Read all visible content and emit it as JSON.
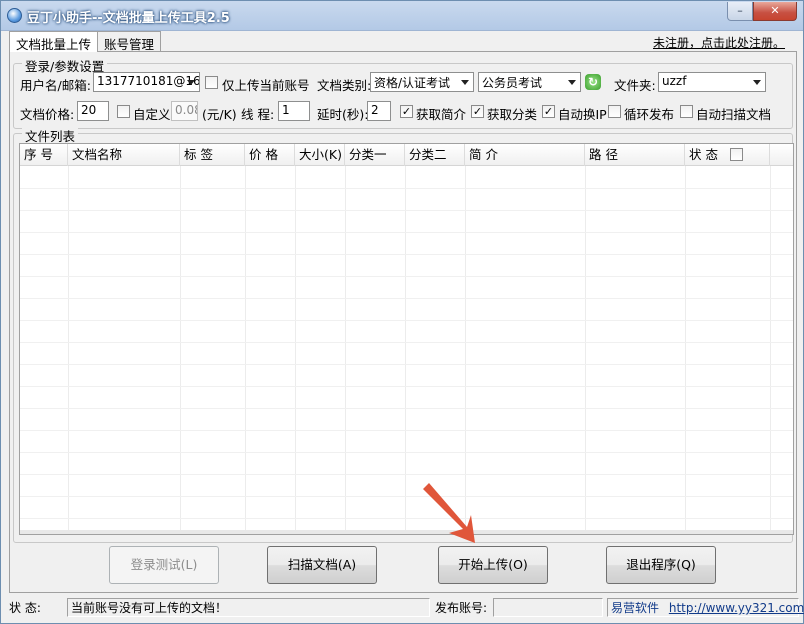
{
  "window": {
    "title": "豆丁小助手--文档批量上传工具2.5",
    "min_label": "–",
    "close_label": "✕"
  },
  "tabs": [
    {
      "label": "文档批量上传",
      "active": true
    },
    {
      "label": "账号管理",
      "active": false
    }
  ],
  "register_link": "未注册，点击此处注册。",
  "login_group": {
    "label": "登录/参数设置",
    "username_label": "用户名/邮箱:",
    "username_value": "1317710181@16.",
    "only_current_label": "仅上传当前账号",
    "only_current_checked": false,
    "doc_type_label": "文档类别:",
    "doc_type_value": "资格/认证考试",
    "doc_subtype_value": "公务员考试",
    "refresh_icon": "refresh-icon",
    "folder_label": "文件夹:",
    "folder_value": "uzzf",
    "price_label": "文档价格:",
    "price_value": "20",
    "custom_label": "自定义",
    "custom_checked": false,
    "custom_value": "0.08",
    "unit_label": "(元/K)",
    "threads_label": "线  程:",
    "threads_value": "1",
    "delay_label": "延时(秒):",
    "delay_value": "2",
    "fetch_intro_label": "获取简介",
    "fetch_intro_checked": true,
    "fetch_category_label": "获取分类",
    "fetch_category_checked": true,
    "auto_ip_label": "自动换IP",
    "auto_ip_checked": true,
    "loop_label": "循环发布",
    "loop_checked": false,
    "auto_scan_label": "自动扫描文档",
    "auto_scan_checked": false
  },
  "file_list": {
    "label": "文件列表",
    "columns": [
      "序  号",
      "文档名称",
      "标  签",
      "价  格",
      "大小(K)",
      "分类一",
      "分类二",
      "简  介",
      "路  径",
      "状  态"
    ],
    "rows": []
  },
  "buttons": {
    "login_test": "登录测试(L)",
    "scan_docs": "扫描文档(A)",
    "start_upload": "开始上传(O)",
    "exit": "退出程序(Q)"
  },
  "status": {
    "label": "状  态:",
    "message": "当前账号没有可上传的文档！",
    "publish_label": "发布账号:",
    "publish_value": "",
    "vendor": "易营软件",
    "url": "http://www.yy321.com"
  },
  "colors": {
    "accent_arrow": "#e0563a"
  }
}
